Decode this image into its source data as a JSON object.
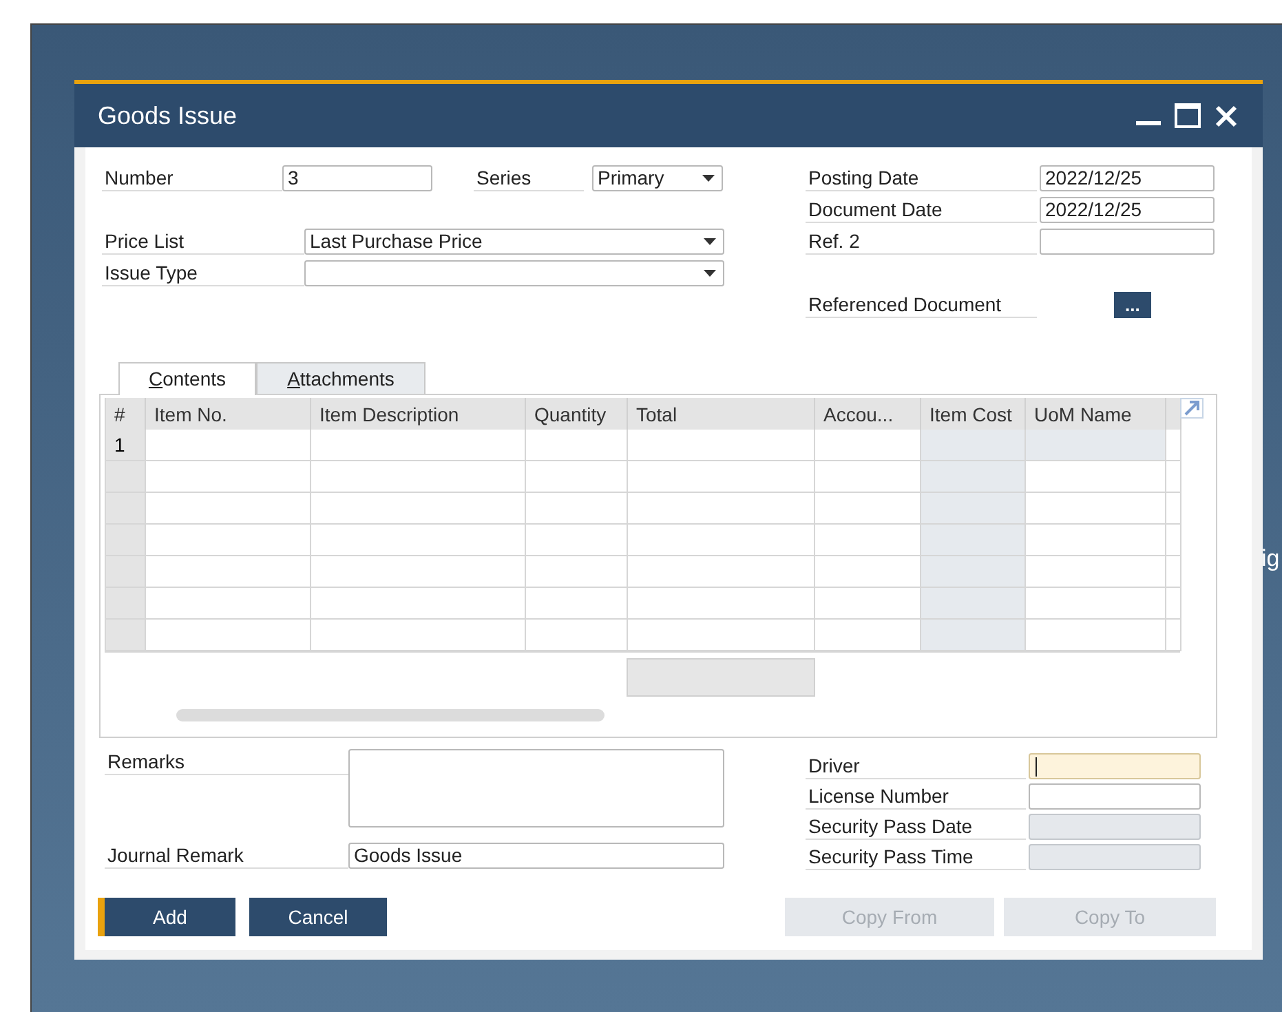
{
  "background_text": "ig",
  "window": {
    "title": "Goods Issue"
  },
  "header_left": [
    {
      "label": "Number",
      "kind": "text",
      "value": "3"
    },
    {
      "label": "Series",
      "kind": "dropdown",
      "value": "Primary"
    },
    {
      "label": "Price List",
      "kind": "dropdown",
      "value": "Last Purchase Price"
    },
    {
      "label": "Issue Type",
      "kind": "dropdown"
    }
  ],
  "header_right": [
    {
      "label": "Posting Date",
      "kind": "text",
      "value": "2022/12/25"
    },
    {
      "label": "Document Date",
      "kind": "text",
      "value": "2022/12/25"
    },
    {
      "label": "Ref. 2",
      "kind": "text"
    },
    {
      "label": "Referenced Document",
      "kind": "lookup",
      "button": "..."
    }
  ],
  "tabs": [
    {
      "label": "Contents",
      "selected": true
    },
    {
      "label": "Attachments",
      "selected": false
    }
  ],
  "table": {
    "columns": [
      {
        "label": "#",
        "kind": "number"
      },
      {
        "label": "Item No.",
        "kind": "editable"
      },
      {
        "label": "Item Description",
        "kind": "editable"
      },
      {
        "label": "Quantity",
        "kind": "editable"
      },
      {
        "label": "Total",
        "kind": "editable",
        "has_total": true
      },
      {
        "label": "Accou...",
        "kind": "editable"
      },
      {
        "label": "Item Cost",
        "kind": "readonly"
      },
      {
        "label": "UoM Name",
        "kind": "row_locked"
      }
    ],
    "rows": [
      {
        "number": "1",
        "locked": true
      },
      {
        "locked": false
      },
      {
        "locked": false
      },
      {
        "locked": false
      },
      {
        "locked": false
      },
      {
        "locked": false
      },
      {
        "locked": false
      }
    ]
  },
  "footer_left": [
    {
      "label": "Remarks",
      "kind": "textarea"
    },
    {
      "label": "Journal Remark",
      "kind": "text",
      "value": "Goods Issue"
    }
  ],
  "footer_right": [
    {
      "label": "Driver",
      "focused": true,
      "disabled": false
    },
    {
      "label": "License Number",
      "focused": false,
      "disabled": false
    },
    {
      "label": "Security Pass Date",
      "focused": false,
      "disabled": true
    },
    {
      "label": "Security Pass Time",
      "focused": false,
      "disabled": true
    }
  ],
  "buttons_left": [
    {
      "label": "Add",
      "default": true,
      "disabled": false
    },
    {
      "label": "Cancel",
      "default": false,
      "disabled": false
    }
  ],
  "buttons_right": [
    {
      "label": "Copy From",
      "default": false,
      "disabled": true
    },
    {
      "label": "Copy To",
      "default": false,
      "disabled": true
    }
  ]
}
